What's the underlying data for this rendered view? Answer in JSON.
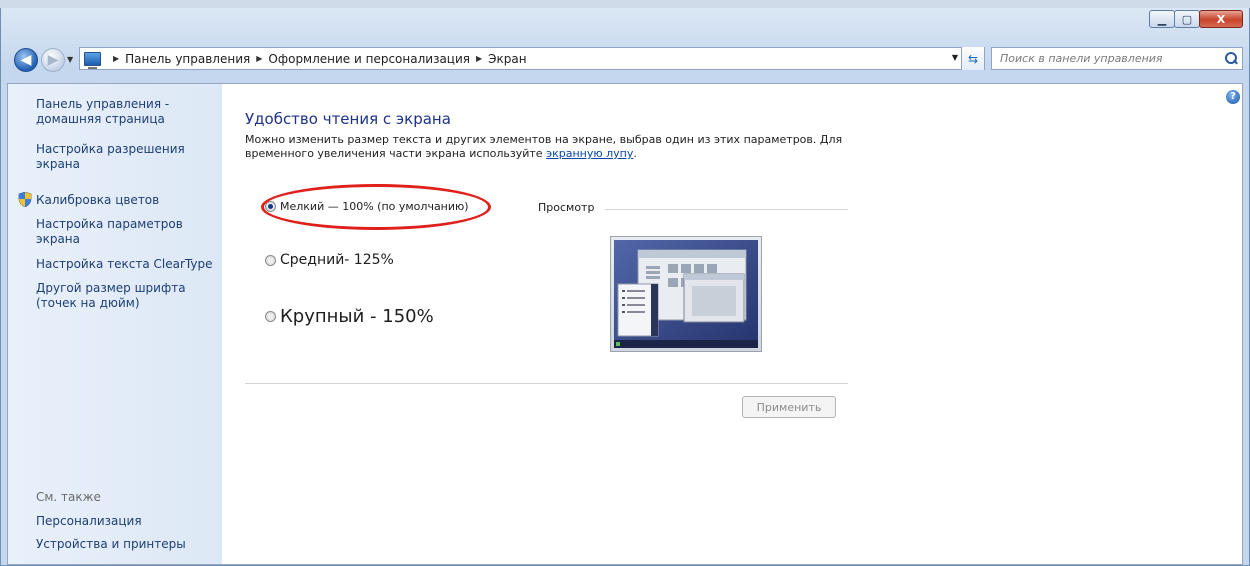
{
  "window": {
    "minimize_glyph": "▁",
    "maximize_glyph": "▢",
    "close_glyph": "X"
  },
  "navigation": {
    "back_glyph": "◀",
    "forward_glyph": "▶",
    "breadcrumbs": [
      "Панель управления",
      "Оформление и персонализация",
      "Экран"
    ],
    "search_placeholder": "Поиск в панели управления"
  },
  "sidebar": {
    "items": [
      "Панель управления - домашняя страница",
      "Настройка разрешения экрана",
      "Калибровка цветов",
      "Настройка параметров экрана",
      "Настройка текста ClearType",
      "Другой размер шрифта (точек на дюйм)"
    ],
    "see_also_label": "См. также",
    "see_also_items": [
      "Персонализация",
      "Устройства и принтеры"
    ]
  },
  "main": {
    "title": "Удобство чтения с экрана",
    "description_part1": "Можно изменить размер текста и других элементов на экране, выбрав один из этих параметров. Для временного увеличения части экрана используйте",
    "magnifier_link": "экранную лупу",
    "description_end": ".",
    "options": [
      {
        "label": "Мелкий — 100% (по умолчанию)",
        "selected": true
      },
      {
        "label": "Средний- 125%",
        "selected": false
      },
      {
        "label": "Крупный - 150%",
        "selected": false
      }
    ],
    "preview_label": "Просмотр",
    "apply_button": "Применить",
    "help_glyph": "?"
  },
  "colors": {
    "link": "#1d3f73",
    "title": "#1e3287",
    "highlight_ring": "#e0201a"
  }
}
